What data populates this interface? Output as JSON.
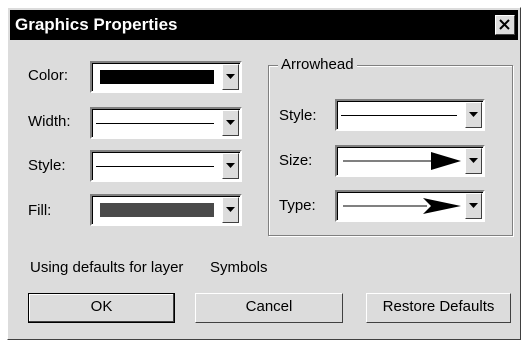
{
  "window": {
    "title": "Graphics Properties",
    "close_glyph": "✕"
  },
  "left": {
    "color_label": "Color:",
    "width_label": "Width:",
    "style_label": "Style:",
    "fill_label": "Fill:",
    "color_value": "#000000",
    "fill_value": "#4a4a4a"
  },
  "arrowhead": {
    "group_label": "Arrowhead",
    "style_label": "Style:",
    "size_label": "Size:",
    "type_label": "Type:"
  },
  "status": {
    "layer_text": "Using defaults for layer",
    "layer_name": "Symbols"
  },
  "buttons": {
    "ok": "OK",
    "cancel": "Cancel",
    "restore": "Restore Defaults"
  },
  "icons": {
    "dropdown": "chevron-down-icon",
    "close": "close-icon",
    "arrow": "arrowhead-icon"
  }
}
